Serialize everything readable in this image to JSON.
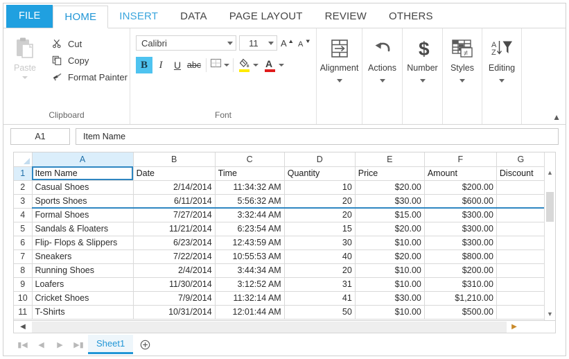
{
  "tabs": [
    {
      "label": "FILE",
      "state": "file"
    },
    {
      "label": "HOME",
      "state": "active"
    },
    {
      "label": "INSERT",
      "state": "accent"
    },
    {
      "label": "DATA",
      "state": "normal"
    },
    {
      "label": "PAGE LAYOUT",
      "state": "normal"
    },
    {
      "label": "REVIEW",
      "state": "normal"
    },
    {
      "label": "OTHERS",
      "state": "normal"
    }
  ],
  "ribbon": {
    "clipboard": {
      "title": "Clipboard",
      "paste_label": "Paste",
      "items": [
        {
          "label": "Cut",
          "icon": "scissors-icon"
        },
        {
          "label": "Copy",
          "icon": "copy-icon"
        },
        {
          "label": "Format Painter",
          "icon": "paintbrush-icon"
        }
      ]
    },
    "font": {
      "title": "Font",
      "font_name": "Calibri",
      "font_size": "11",
      "grow_font": "A",
      "shrink_font": "A",
      "bold": "B",
      "italic": "I",
      "underline": "U",
      "strikethrough": "abc",
      "borders_icon": "borders-icon",
      "fill_color_icon": "fill-color-icon",
      "fill_color": "#ffeb00",
      "font_color_icon": "font-color-icon",
      "font_color": "#e01b1b"
    },
    "groups": [
      {
        "label": "Alignment",
        "icon": "alignment-icon"
      },
      {
        "label": "Actions",
        "icon": "undo-icon"
      },
      {
        "label": "Number",
        "icon": "currency-icon"
      },
      {
        "label": "Styles",
        "icon": "styles-icon"
      },
      {
        "label": "Editing",
        "icon": "sort-filter-icon"
      }
    ],
    "collapse_icon": "chevron-up-icon"
  },
  "formula_bar": {
    "name_box": "A1",
    "formula_value": "Item Name"
  },
  "grid": {
    "columns": [
      "A",
      "B",
      "C",
      "D",
      "E",
      "F",
      "G"
    ],
    "selected_column": "A",
    "selected_row": "1",
    "selected_cell": "A1",
    "split_after_row": 3,
    "headers": [
      "Item Name",
      "Date",
      "Time",
      "Quantity",
      "Price",
      "Amount",
      "Discount"
    ],
    "rows": [
      {
        "n": "1",
        "cells": [
          "Item Name",
          "Date",
          "Time",
          "Quantity",
          "Price",
          "Amount",
          "Discount"
        ]
      },
      {
        "n": "2",
        "cells": [
          "Casual Shoes",
          "2/14/2014",
          "11:34:32 AM",
          "10",
          "$20.00",
          "$200.00",
          ""
        ]
      },
      {
        "n": "3",
        "cells": [
          "Sports Shoes",
          "6/11/2014",
          "5:56:32 AM",
          "20",
          "$30.00",
          "$600.00",
          ""
        ]
      },
      {
        "n": "4",
        "cells": [
          "Formal Shoes",
          "7/27/2014",
          "3:32:44 AM",
          "20",
          "$15.00",
          "$300.00",
          ""
        ]
      },
      {
        "n": "5",
        "cells": [
          "Sandals & Floaters",
          "11/21/2014",
          "6:23:54 AM",
          "15",
          "$20.00",
          "$300.00",
          ""
        ]
      },
      {
        "n": "6",
        "cells": [
          "Flip- Flops & Slippers",
          "6/23/2014",
          "12:43:59 AM",
          "30",
          "$10.00",
          "$300.00",
          ""
        ]
      },
      {
        "n": "7",
        "cells": [
          "Sneakers",
          "7/22/2014",
          "10:55:53 AM",
          "40",
          "$20.00",
          "$800.00",
          ""
        ]
      },
      {
        "n": "8",
        "cells": [
          "Running Shoes",
          "2/4/2014",
          "3:44:34 AM",
          "20",
          "$10.00",
          "$200.00",
          ""
        ]
      },
      {
        "n": "9",
        "cells": [
          "Loafers",
          "11/30/2014",
          "3:12:52 AM",
          "31",
          "$10.00",
          "$310.00",
          ""
        ]
      },
      {
        "n": "10",
        "cells": [
          "Cricket Shoes",
          "7/9/2014",
          "11:32:14 AM",
          "41",
          "$30.00",
          "$1,210.00",
          ""
        ]
      },
      {
        "n": "11",
        "cells": [
          "T-Shirts",
          "10/31/2014",
          "12:01:44 AM",
          "50",
          "$10.00",
          "$500.00",
          ""
        ]
      }
    ],
    "scroll_up_icon": "chevron-up-icon",
    "scroll_down_icon": "chevron-down-icon"
  },
  "hscroll": {
    "left_icon": "chevron-left-icon",
    "right_icon": "chevron-right-icon"
  },
  "sheetbar": {
    "first_icon": "first-sheet-icon",
    "prev_icon": "prev-sheet-icon",
    "next_icon": "next-sheet-icon",
    "last_icon": "last-sheet-icon",
    "tabs": [
      {
        "label": "Sheet1",
        "active": true
      }
    ],
    "add_icon": "add-sheet-icon"
  },
  "colors": {
    "accent": "#2196d6",
    "file_tab": "#20a0e0",
    "selection": "#2e86c1",
    "header_select": "#dbeefb"
  }
}
